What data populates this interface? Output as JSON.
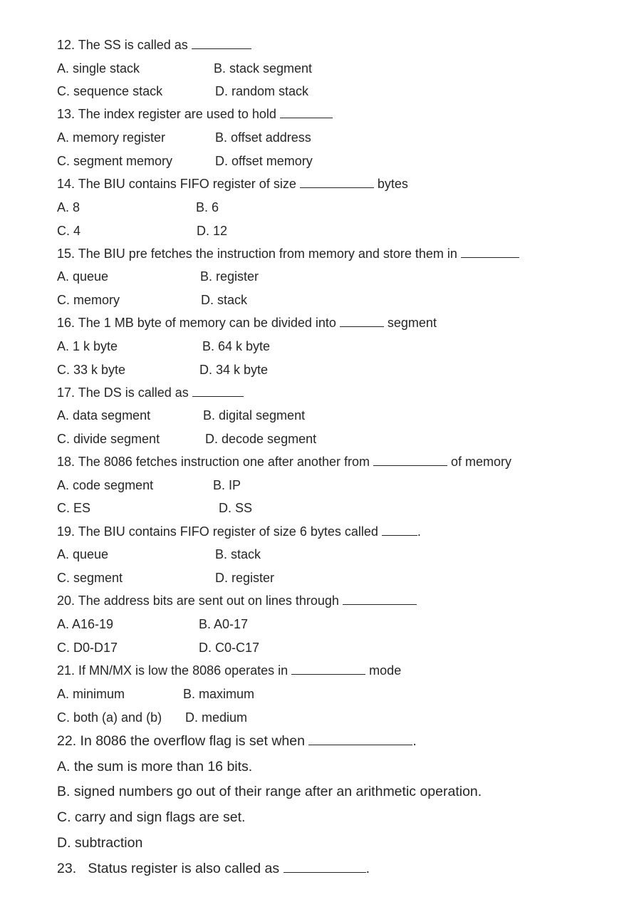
{
  "questions": [
    {
      "number": "12.",
      "stem_before": " The SS is called as ",
      "stem_after": "",
      "options": {
        "A": "A. single stack",
        "B": "B. stack segment",
        "C": "C. sequence stack",
        "D": "D. random stack"
      }
    },
    {
      "number": "13.",
      "stem_before": "The index register are used to hold ",
      "stem_after": "",
      "options": {
        "A": "A. memory register",
        "B": "B. offset address",
        "C": "C. segment memory",
        "D": "D. offset memory"
      }
    },
    {
      "number": "14.",
      "stem_before": "The BIU contains FIFO register of size ",
      "stem_after": " bytes",
      "options": {
        "A": "A. 8",
        "B": "B. 6",
        "C": "C. 4",
        "D": "D. 12"
      }
    },
    {
      "number": "15.",
      "stem_before": "The BIU pre fetches the instruction from memory and store them in ",
      "stem_after": "",
      "options": {
        "A": "A. queue",
        "B": "B. register",
        "C": "C. memory",
        "D": "D. stack"
      }
    },
    {
      "number": "16.",
      "stem_before": "The 1 MB byte of memory can be divided into ",
      "stem_after": " segment",
      "options": {
        "A": "A. 1 k byte",
        "B": "B. 64 k byte",
        "C": "C. 33 k byte",
        "D": "D. 34 k byte"
      }
    },
    {
      "number": "17.",
      "stem_before": "The DS is called as ",
      "stem_after": "",
      "options": {
        "A": "A. data segment",
        "B": "B. digital segment",
        "C": "C. divide segment",
        "D": "D. decode segment"
      }
    },
    {
      "number": "18.",
      "stem_before": "The 8086 fetches instruction one after another from ",
      "stem_after": " of memory",
      "options": {
        "A": "A. code segment",
        "B": "B. IP",
        "C": "C. ES",
        "D": "D. SS"
      }
    },
    {
      "number": "19.",
      "stem_before": " The BIU contains FIFO register of size 6 bytes called ",
      "stem_after": ".",
      "options": {
        "A": "A. queue",
        "B": "B. stack",
        "C": "C. segment",
        "D": "D. register"
      }
    },
    {
      "number": "20.",
      "stem_before": "The address bits are sent out on lines through ",
      "stem_after": "",
      "options": {
        "A": "A. A16-19",
        "B": "B. A0-17",
        "C": "C. D0-D17",
        "D": "D. C0-C17"
      }
    },
    {
      "number": "21.",
      "stem_before": " If MN/MX is low the 8086 operates in ",
      "stem_after": " mode",
      "options": {
        "A": "A. minimum",
        "B": "B. maximum",
        "C": "C. both (a) and (b)",
        "D": "D. medium"
      }
    },
    {
      "number": "22.",
      "stem_before": "In 8086 the overflow flag is set when ",
      "stem_after": ".",
      "options": {
        "A": "A. the sum is more than 16 bits.",
        "B": "B. signed numbers go out of their range after an arithmetic operation.",
        "C": "C. carry and sign flags are set.",
        "D": "D. subtraction"
      }
    },
    {
      "number": "23.",
      "stem_before": "   Status register is also called as ",
      "stem_after": ".",
      "options": {}
    }
  ]
}
